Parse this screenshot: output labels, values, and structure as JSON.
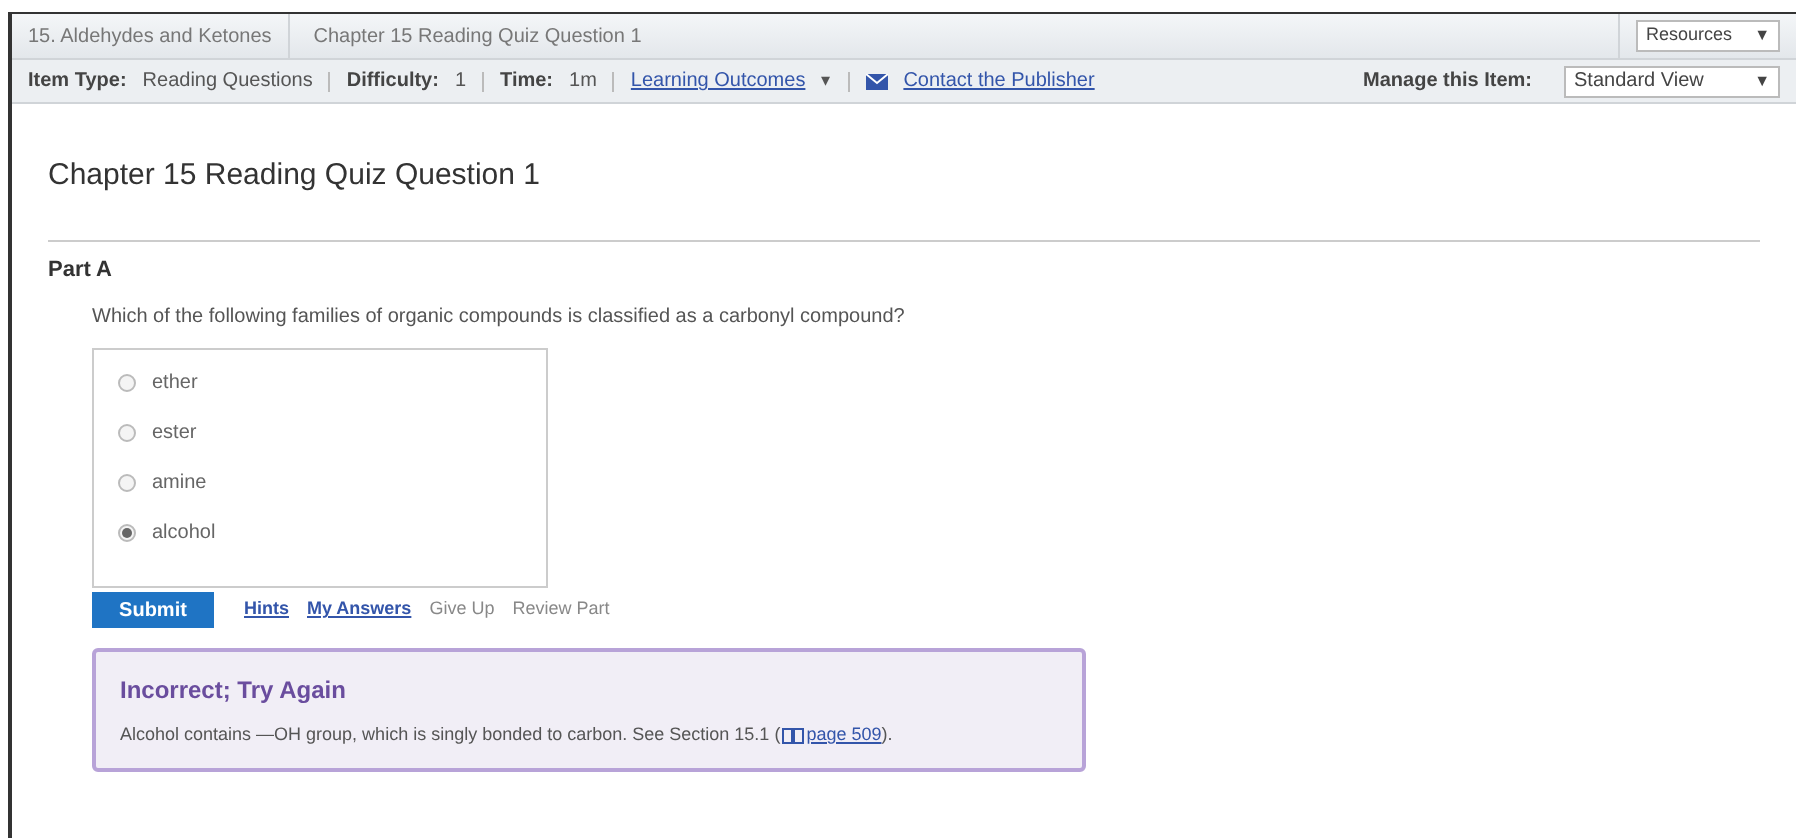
{
  "breadcrumb": [
    "15. Aldehydes and Ketones",
    "Chapter 15 Reading Quiz Question 1"
  ],
  "resources": {
    "value": "Resources",
    "caret": "▼"
  },
  "info_bar": {
    "items": [
      {
        "label": "Item Type:",
        "value": "Reading Questions"
      },
      {
        "label": "Difficulty:",
        "value": "1"
      },
      {
        "label": "Time:",
        "value": "1m"
      }
    ],
    "learning_outcomes": "Learning Outcomes",
    "learning_caret": "▾",
    "contact": "Contact the Publisher",
    "manage_label": "Manage this Item:",
    "manage_value": "Standard View",
    "manage_caret": "▼"
  },
  "title": "Chapter 15 Reading Quiz Question 1",
  "part": "Part A",
  "question": "Which of the following families of organic compounds is classified as a carbonyl compound?",
  "options": [
    {
      "label": "ether",
      "selected": false
    },
    {
      "label": "ester",
      "selected": false
    },
    {
      "label": "amine",
      "selected": false
    },
    {
      "label": "alcohol",
      "selected": true
    }
  ],
  "actions": [
    {
      "kind": "primary",
      "label": "Submit",
      "disabled": false
    },
    {
      "kind": "link",
      "label": "Hints",
      "disabled": false
    },
    {
      "kind": "link",
      "label": "My Answers",
      "disabled": false
    },
    {
      "kind": "link",
      "label": "Give Up",
      "disabled": true
    },
    {
      "kind": "link",
      "label": "Review Part",
      "disabled": true
    }
  ],
  "feedback": {
    "heading": "Incorrect; Try Again",
    "text": "Alcohol contains —OH group, which is singly bonded to carbon. See Section 15.1 (",
    "link": "page 509",
    "after": ")."
  }
}
